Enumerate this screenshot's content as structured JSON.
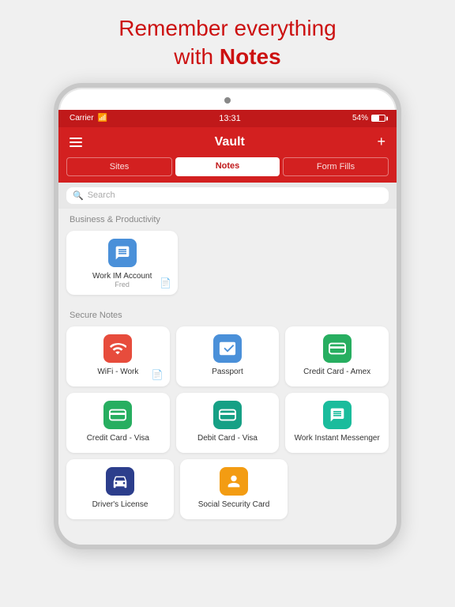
{
  "headline": {
    "line1": "Remember everything",
    "line2_prefix": "with ",
    "line2_bold": "Notes"
  },
  "status_bar": {
    "carrier": "Carrier",
    "time": "13:31",
    "battery": "54%"
  },
  "navbar": {
    "title": "Vault",
    "menu_icon": "≡",
    "add_icon": "+"
  },
  "tabs": [
    {
      "label": "Sites",
      "active": false
    },
    {
      "label": "Notes",
      "active": true
    },
    {
      "label": "Form Fills",
      "active": false
    }
  ],
  "search": {
    "placeholder": "Search"
  },
  "sections": [
    {
      "name": "Business & Productivity",
      "items": [
        {
          "label": "Work IM Account",
          "sublabel": "Fred",
          "icon": "chat",
          "icon_color": "blue",
          "has_note": true
        }
      ]
    },
    {
      "name": "Secure Notes",
      "items": [
        {
          "label": "WiFi - Work",
          "icon": "wifi",
          "icon_color": "red",
          "has_note": true
        },
        {
          "label": "Passport",
          "icon": "plane",
          "icon_color": "blue"
        },
        {
          "label": "Credit Card - Amex",
          "icon": "card",
          "icon_color": "green"
        },
        {
          "label": "Credit Card - Visa",
          "icon": "card",
          "icon_color": "green"
        },
        {
          "label": "Debit Card - Visa",
          "icon": "card",
          "icon_color": "teal"
        },
        {
          "label": "Work Instant Messenger",
          "icon": "chat",
          "icon_color": "cyan"
        },
        {
          "label": "Driver's License",
          "icon": "car",
          "icon_color": "dark-blue"
        },
        {
          "label": "Social Security Card",
          "icon": "person",
          "icon_color": "yellow"
        }
      ]
    }
  ],
  "icons": {
    "chat": "💬",
    "wifi": "📶",
    "plane": "✈",
    "card": "💳",
    "car": "🚗",
    "person": "👤",
    "search": "🔍",
    "note": "📄",
    "hamburger": "☰",
    "plus": "+"
  }
}
